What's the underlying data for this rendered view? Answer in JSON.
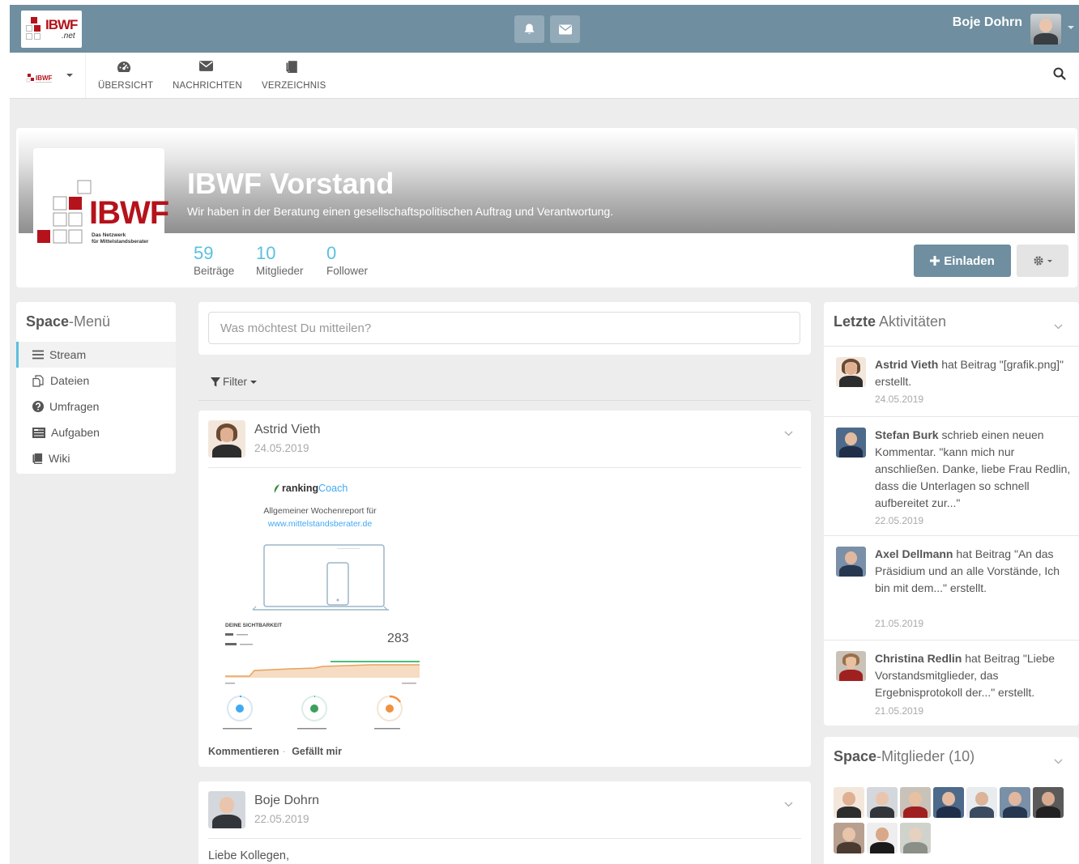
{
  "topbar": {
    "logo_text": "IBWF",
    "logo_sub": ".net",
    "user_name": "Boje Dohrn",
    "icons": [
      "bell-icon",
      "envelope-icon"
    ]
  },
  "nav": {
    "items": [
      {
        "label": "ÜBERSICHT",
        "icon": "dashboard-icon"
      },
      {
        "label": "NACHRICHTEN",
        "icon": "envelope-icon"
      },
      {
        "label": "VERZEICHNIS",
        "icon": "book-icon"
      }
    ]
  },
  "space": {
    "title": "IBWF Vorstand",
    "description": "Wir haben in der Beratung einen gesellschaftspolitischen Auftrag und Verantwortung.",
    "logo_text": "IBWF",
    "logo_sub1": "Das Netzwerk",
    "logo_sub2": "für Mittelstandsberater",
    "stats": [
      {
        "num": "59",
        "label": "Beiträge"
      },
      {
        "num": "10",
        "label": "Mitglieder"
      },
      {
        "num": "0",
        "label": "Follower"
      }
    ],
    "invite_label": "Einladen"
  },
  "menu": {
    "title_bold": "Space",
    "title_rest": "-Menü",
    "items": [
      {
        "label": "Stream",
        "icon": "list-icon"
      },
      {
        "label": "Dateien",
        "icon": "files-icon"
      },
      {
        "label": "Umfragen",
        "icon": "question-icon"
      },
      {
        "label": "Aufgaben",
        "icon": "tasks-icon"
      },
      {
        "label": "Wiki",
        "icon": "book-icon"
      }
    ]
  },
  "composer": {
    "placeholder": "Was möchtest Du mitteilen?"
  },
  "filter_label": "Filter",
  "posts": [
    {
      "author": "Astrid Vieth",
      "date": "24.05.2019",
      "report": {
        "brand_a": "ranking",
        "brand_b": "Coach",
        "subtitle": "Allgemeiner Wochenreport für",
        "link": "www.mittelstandsberater.de",
        "visibility_label": "DEINE SICHTBARKEIT",
        "visibility_value": "283"
      },
      "action_comment": "Kommentieren",
      "action_like": "Gefällt mir"
    },
    {
      "author": "Boje Dohrn",
      "date": "22.05.2019",
      "text": "Liebe Kollegen,"
    }
  ],
  "activities": {
    "title_bold": "Letzte",
    "title_rest": " Aktivitäten",
    "items": [
      {
        "name": "Astrid Vieth",
        "text": " hat Beitrag \"[grafik.png]\" erstellt.",
        "date": "24.05.2019"
      },
      {
        "name": "Stefan Burk",
        "text": " schrieb einen neuen Kommentar. \"kann mich nur anschließen. Danke, liebe Frau Redlin, dass die Unterlagen so schnell aufbereitet zur...\"",
        "date": "22.05.2019"
      },
      {
        "name": "Axel Dellmann",
        "text": " hat Beitrag \"An das Präsidium und an alle Vorstände, Ich bin mit dem...\" erstellt.",
        "date": "21.05.2019"
      },
      {
        "name": "Christina Redlin",
        "text": " hat Beitrag \"Liebe Vorstandsmitglieder, das Ergebnisprotokoll der...\" erstellt.",
        "date": "21.05.2019"
      }
    ]
  },
  "members": {
    "title_bold": "Space",
    "title_rest": "-Mitglieder (10)"
  },
  "colors": {
    "topbar": "#6f8ea0",
    "accent": "#5bc0de",
    "brand_red": "#b5121b"
  }
}
